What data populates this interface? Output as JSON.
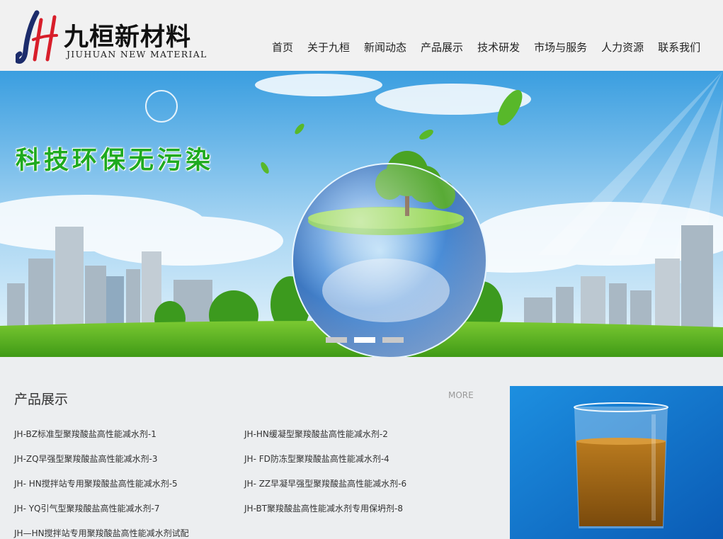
{
  "brand": {
    "name_cn": "九桓新材料",
    "name_en": "JIUHUAN NEW MATERIAL",
    "logo_icon": "jh-logo-icon",
    "colors": {
      "navy": "#1c2c6b",
      "red": "#d81e2a"
    }
  },
  "nav": {
    "items": [
      {
        "label": "首页"
      },
      {
        "label": "关于九桓"
      },
      {
        "label": "新闻动态"
      },
      {
        "label": "产品展示"
      },
      {
        "label": "技术研发"
      },
      {
        "label": "市场与服务"
      },
      {
        "label": "人力资源"
      },
      {
        "label": "联系我们"
      }
    ]
  },
  "banner": {
    "slogan": "科技环保无污染",
    "slogan_color": "#1faa1f",
    "slides_count": 3,
    "active_slide": 2
  },
  "products": {
    "title": "产品展示",
    "more": "MORE",
    "items": [
      {
        "name": "JH-BZ标准型聚羧酸盐高性能减水剂-1"
      },
      {
        "name": "JH-HN缓凝型聚羧酸盐高性能减水剂-2"
      },
      {
        "name": "JH-ZQ早强型聚羧酸盐高性能减水剂-3"
      },
      {
        "name": "JH- FD防冻型聚羧酸盐高性能减水剂-4"
      },
      {
        "name": "JH- HN搅拌站专用聚羧酸盐高性能减水剂-5"
      },
      {
        "name": "JH- ZZ早凝早强型聚羧酸盐高性能减水剂-6"
      },
      {
        "name": "JH- YQ引气型聚羧酸盐高性能减水剂-7"
      },
      {
        "name": "JH-BT聚羧酸盐高性能减水剂专用保坍剂-8"
      },
      {
        "name": "JH—HN搅拌站专用聚羧酸盐高性能减水剂试配"
      }
    ]
  }
}
